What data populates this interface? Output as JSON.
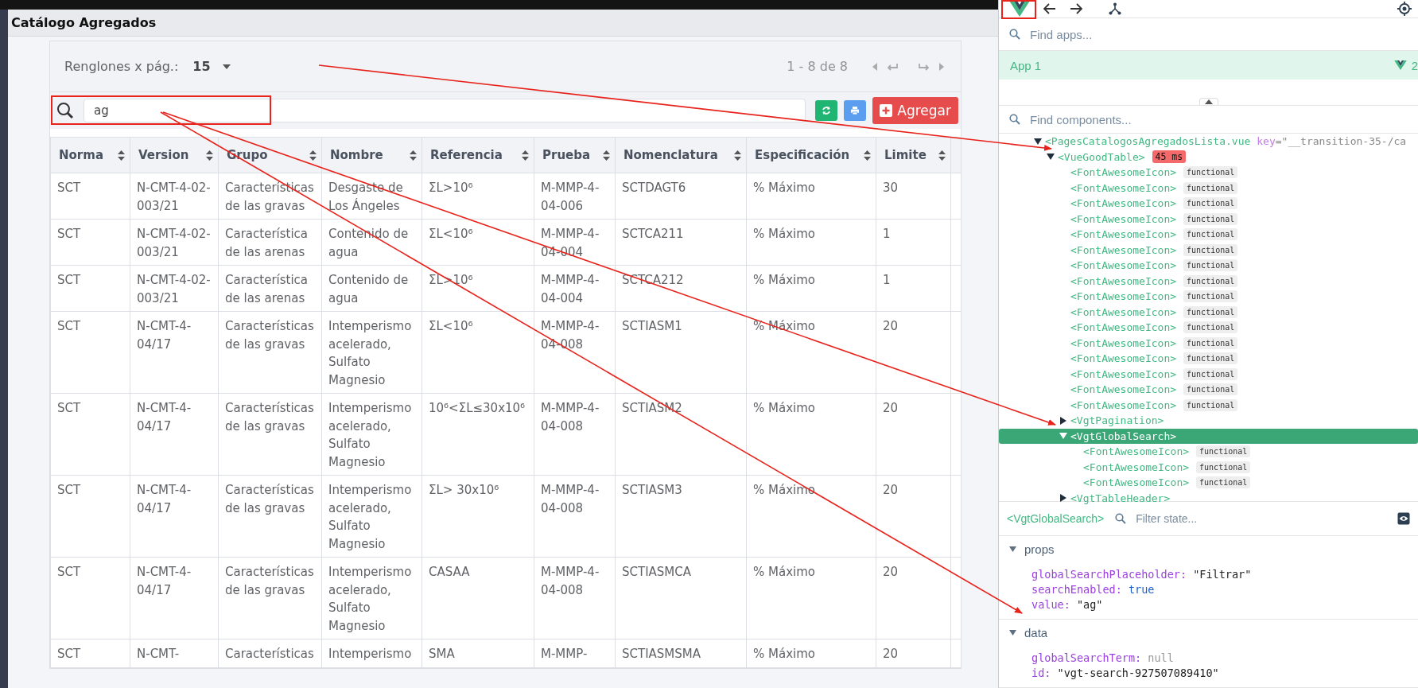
{
  "page_title": "Catálogo Agregados",
  "pagination": {
    "rows_per_page_label": "Renglones x pág.:",
    "rows_per_page": "15",
    "range": "1 - 8 de 8"
  },
  "search": {
    "value": "ag"
  },
  "add_button": "Agregar",
  "table": {
    "columns": [
      "Norma",
      "Version",
      "Grupo",
      "Nombre",
      "Referencia",
      "Prueba",
      "Nomenclatura",
      "Especificación",
      "Limite"
    ],
    "rows": [
      [
        "SCT",
        "N-CMT-4-02-003/21",
        "Características de las gravas",
        "Desgaste de Los Ángeles",
        "ΣL>10⁶",
        "M-MMP-4-04-006",
        "SCTDAGT6",
        "% Máximo",
        "30"
      ],
      [
        "SCT",
        "N-CMT-4-02-003/21",
        "Característica de las arenas",
        "Contenido de agua",
        "ΣL<10⁶",
        "M-MMP-4-04-004",
        "SCTCA211",
        "% Máximo",
        "1"
      ],
      [
        "SCT",
        "N-CMT-4-02-003/21",
        "Característica de las arenas",
        "Contenido de agua",
        "ΣL>10⁶",
        "M-MMP-4-04-004",
        "SCTCA212",
        "% Máximo",
        "1"
      ],
      [
        "SCT",
        "N-CMT-4-04/17",
        "Características de las gravas",
        "Intemperismo acelerado, Sulfato Magnesio",
        "ΣL<10⁶",
        "M-MMP-4-04-008",
        "SCTIASM1",
        "% Máximo",
        "20"
      ],
      [
        "SCT",
        "N-CMT-4-04/17",
        "Características de las gravas",
        "Intemperismo acelerado, Sulfato Magnesio",
        "10⁶<ΣL≤30x10⁶",
        "M-MMP-4-04-008",
        "SCTIASM2",
        "% Máximo",
        "20"
      ],
      [
        "SCT",
        "N-CMT-4-04/17",
        "Características de las gravas",
        "Intemperismo acelerado, Sulfato Magnesio",
        "ΣL> 30x10⁶",
        "M-MMP-4-04-008",
        "SCTIASM3",
        "% Máximo",
        "20"
      ],
      [
        "SCT",
        "N-CMT-4-04/17",
        "Características de las gravas",
        "Intemperismo acelerado, Sulfato Magnesio",
        "CASAA",
        "M-MMP-4-04-008",
        "SCTIASMCA",
        "% Máximo",
        "20"
      ],
      [
        "SCT",
        "N-CMT-",
        "Características",
        "Intemperismo",
        "SMA",
        "M-MMP-",
        "SCTIASMSMA",
        "% Máximo",
        "20"
      ]
    ]
  },
  "devtools": {
    "find_apps_placeholder": "Find apps...",
    "app": {
      "name": "App 1",
      "count": "2"
    },
    "find_components_placeholder": "Find components...",
    "tree": [
      {
        "name": "<PagesCatalogosAgregadosLista.vue",
        "attr_name": "key",
        "attr_value": "=\"__transition-35-/ca",
        "expanded": true,
        "selected": false,
        "children": [
          {
            "name": "<VueGoodTable>",
            "badge": "45 ms",
            "expanded": true,
            "selected": false,
            "children": [
              {
                "name": "<FontAwesomeIcon>",
                "tag": "functional",
                "selected": false
              },
              {
                "name": "<FontAwesomeIcon>",
                "tag": "functional",
                "selected": false
              },
              {
                "name": "<FontAwesomeIcon>",
                "tag": "functional",
                "selected": false
              },
              {
                "name": "<FontAwesomeIcon>",
                "tag": "functional",
                "selected": false
              },
              {
                "name": "<FontAwesomeIcon>",
                "tag": "functional",
                "selected": false
              },
              {
                "name": "<FontAwesomeIcon>",
                "tag": "functional",
                "selected": false
              },
              {
                "name": "<FontAwesomeIcon>",
                "tag": "functional",
                "selected": false
              },
              {
                "name": "<FontAwesomeIcon>",
                "tag": "functional",
                "selected": false
              },
              {
                "name": "<FontAwesomeIcon>",
                "tag": "functional",
                "selected": false
              },
              {
                "name": "<FontAwesomeIcon>",
                "tag": "functional",
                "selected": false
              },
              {
                "name": "<FontAwesomeIcon>",
                "tag": "functional",
                "selected": false
              },
              {
                "name": "<FontAwesomeIcon>",
                "tag": "functional",
                "selected": false
              },
              {
                "name": "<FontAwesomeIcon>",
                "tag": "functional",
                "selected": false
              },
              {
                "name": "<FontAwesomeIcon>",
                "tag": "functional",
                "selected": false
              },
              {
                "name": "<FontAwesomeIcon>",
                "tag": "functional",
                "selected": false
              },
              {
                "name": "<FontAwesomeIcon>",
                "tag": "functional",
                "selected": false
              },
              {
                "name": "<VgtPagination>",
                "expanded": false,
                "selected": false
              },
              {
                "name": "<VgtGlobalSearch>",
                "expanded": true,
                "selected": true,
                "children": [
                  {
                    "name": "<FontAwesomeIcon>",
                    "tag": "functional",
                    "selected": false
                  },
                  {
                    "name": "<FontAwesomeIcon>",
                    "tag": "functional",
                    "selected": false
                  },
                  {
                    "name": "<FontAwesomeIcon>",
                    "tag": "functional",
                    "selected": false
                  }
                ]
              },
              {
                "name": "<VgtTableHeader>",
                "expanded": false,
                "selected": false
              }
            ]
          }
        ]
      }
    ],
    "inspector": {
      "component": "<VgtGlobalSearch>",
      "filter_placeholder": "Filter state...",
      "sections": [
        {
          "title": "props",
          "expanded": true,
          "entries": [
            {
              "key": "globalSearchPlaceholder:",
              "value": "\"Filtrar\"",
              "kind": "string"
            },
            {
              "key": "searchEnabled:",
              "value": "true",
              "kind": "boolean"
            },
            {
              "key": "value:",
              "value": "\"ag\"",
              "kind": "string"
            }
          ]
        },
        {
          "title": "data",
          "expanded": true,
          "entries": [
            {
              "key": "globalSearchTerm:",
              "value": "null",
              "kind": "null"
            },
            {
              "key": "id:",
              "value": "\"vgt-search-927507089410\"",
              "kind": "string"
            }
          ]
        }
      ]
    }
  }
}
